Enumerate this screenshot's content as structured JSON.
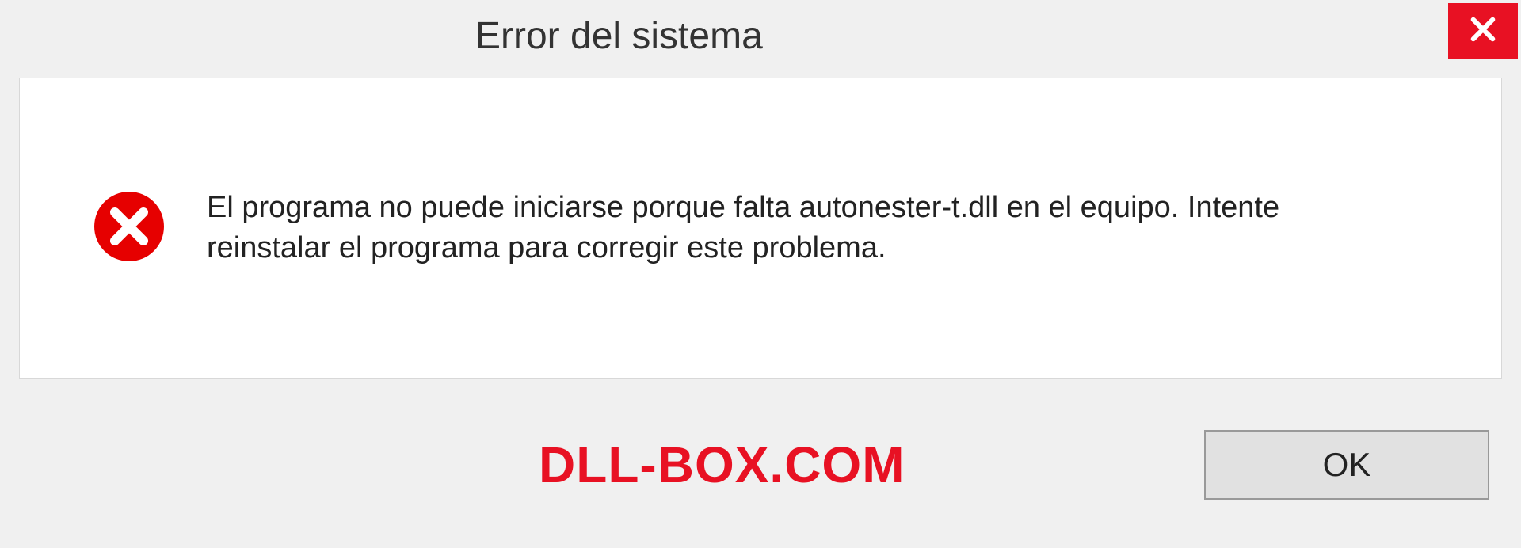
{
  "dialog": {
    "title": "Error del sistema",
    "message": "El programa no puede iniciarse porque falta autonester-t.dll en el equipo. Intente reinstalar el programa para corregir este problema.",
    "ok_label": "OK"
  },
  "watermark": {
    "text": "DLL-BOX.COM"
  },
  "colors": {
    "error_red": "#e81123",
    "close_red": "#e81123"
  }
}
